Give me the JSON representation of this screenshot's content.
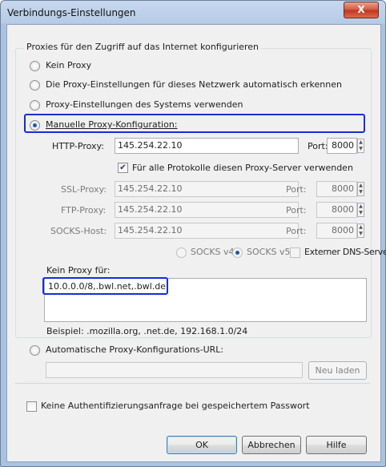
{
  "window": {
    "title": "Verbindungs-Einstellungen",
    "close_glyph": "X"
  },
  "group_label": "Proxies für den Zugriff auf das Internet konfigurieren",
  "options": {
    "no_proxy": "Kein Proxy",
    "auto_detect": "Die Proxy-Einstellungen für dieses Netzwerk automatisch erkennen",
    "system": "Proxy-Einstellungen des Systems verwenden",
    "manual": "Manuelle Proxy-Konfiguration:",
    "auto_url": "Automatische Proxy-Konfigurations-URL:"
  },
  "http": {
    "label": "HTTP-Proxy:",
    "value": "145.254.22.10",
    "port_label": "Port:",
    "port": "8000"
  },
  "all_protocols": "Für alle Protokolle diesen Proxy-Server verwenden",
  "ssl": {
    "label": "SSL-Proxy:",
    "value": "145.254.22.10",
    "port_label": "Port:",
    "port": "8000"
  },
  "ftp": {
    "label": "FTP-Proxy:",
    "value": "145.254.22.10",
    "port_label": "Port:",
    "port": "8000"
  },
  "socks": {
    "label": "SOCKS-Host:",
    "value": "145.254.22.10",
    "port_label": "Port:",
    "port": "8000"
  },
  "socks_v4": "SOCKS v4",
  "socks_v5": "SOCKS v5",
  "remote_dns": "Externer DNS-Server",
  "no_proxy_for": {
    "label": "Kein Proxy für:",
    "value": "10.0.0.0/8,.bwl.net,.bwl.de",
    "example": "Beispiel: .mozilla.org, .net.de, 192.168.1.0/24"
  },
  "reload_button": "Neu laden",
  "no_auth_prompt": "Keine Authentifizierungsanfrage bei gespeichertem Passwort",
  "buttons": {
    "ok": "OK",
    "cancel": "Abbrechen",
    "help": "Hilfe"
  },
  "colors": {
    "highlight": "#1030d8",
    "titlebar": "#b6cbe6"
  }
}
